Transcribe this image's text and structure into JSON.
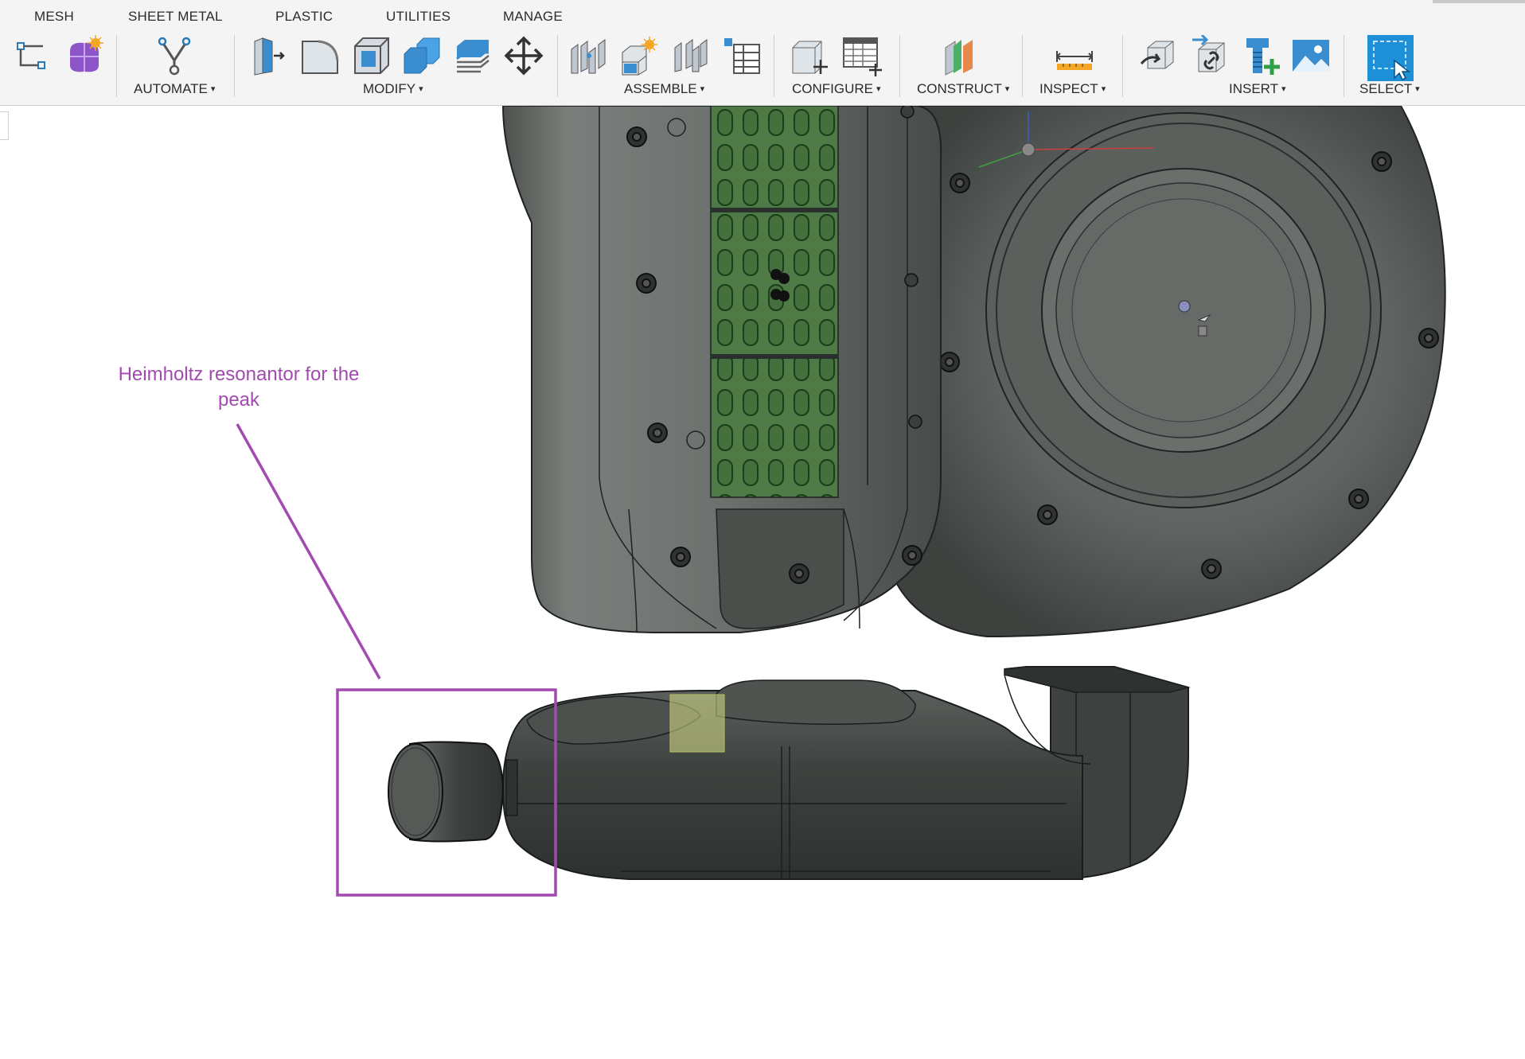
{
  "tabs": [
    "MESH",
    "SHEET METAL",
    "PLASTIC",
    "UTILITIES",
    "MANAGE"
  ],
  "groups": {
    "automate": "AUTOMATE",
    "modify": "MODIFY",
    "assemble": "ASSEMBLE",
    "configure": "CONFIGURE",
    "construct": "CONSTRUCT",
    "inspect": "INSPECT",
    "insert": "INSERT",
    "select": "SELECT"
  },
  "caret": "▾",
  "icons": [
    "sketch-constraint-icon",
    "create-form-icon",
    "automate-generative-icon",
    "press-pull-icon",
    "fillet-icon",
    "shell-icon",
    "combine-icon",
    "offset-face-icon",
    "move-icon",
    "joint-icon",
    "new-component-icon",
    "as-built-joint-icon",
    "bill-of-materials-icon",
    "parameters-icon",
    "configuration-table-icon",
    "offset-plane-icon",
    "measure-icon",
    "insert-derive-icon",
    "insert-link-icon",
    "insert-mcmaster-icon",
    "insert-canvas-icon",
    "window-select-icon"
  ],
  "annotation": {
    "text_line1": "Heimholtz resonantor for the",
    "text_line2": "peak",
    "color": "#a24ab0"
  },
  "colors": {
    "body_dark": "#3e4340",
    "body_mid": "#5a5f5c",
    "foam_green": "#4d7a45",
    "highlight_yellow": "#d9e08a",
    "select_blue": "#1e90d8"
  }
}
